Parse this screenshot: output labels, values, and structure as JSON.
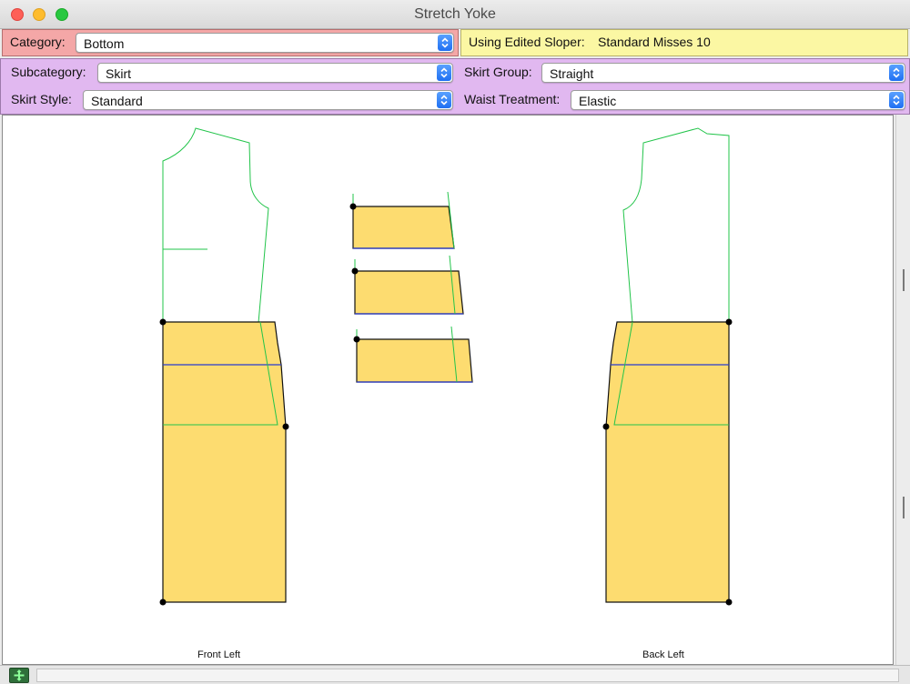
{
  "window": {
    "title": "Stretch Yoke"
  },
  "row1": {
    "category_label": "Category:",
    "category_value": "Bottom",
    "sloper_label": "Using Edited Sloper:",
    "sloper_value": "Standard Misses 10"
  },
  "row2": {
    "subcategory_label": "Subcategory:",
    "subcategory_value": "Skirt",
    "skirt_group_label": "Skirt Group:",
    "skirt_group_value": "Straight"
  },
  "row3": {
    "skirt_style_label": "Skirt Style:",
    "skirt_style_value": "Standard",
    "waist_treatment_label": "Waist Treatment:",
    "waist_treatment_value": "Elastic"
  },
  "canvas": {
    "front_label": "Front Left",
    "back_label": "Back Left"
  },
  "colors": {
    "piece_fill": "#fddc70",
    "sloper_line": "#22c44a",
    "seam_line": "#2a3bd0",
    "category_bg": "#f4a7a7",
    "sloper_bg": "#fbf7a3",
    "control_bg": "#e1b8f0"
  },
  "icons": {
    "dropdown": "chevron-updown-icon",
    "add_piece": "plus-cross-icon"
  }
}
